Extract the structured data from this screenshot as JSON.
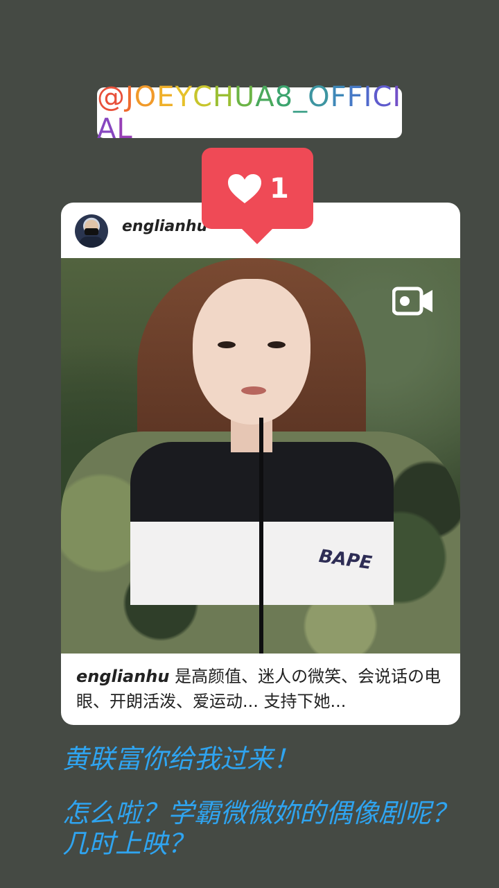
{
  "mention": {
    "text": "@JOEYCHUA8_OFFICIAL",
    "colors": [
      "#e8503a",
      "#ee6a2e",
      "#f19a2a",
      "#efb02a",
      "#e6c12a",
      "#c7c52c",
      "#9bbf34",
      "#6cb446",
      "#4aa95c",
      "#3ca46e",
      "#3b9f87",
      "#3d95a1",
      "#3f88b8",
      "#4679c6",
      "#5069cc",
      "#5f5bcd",
      "#7350c8",
      "#8646bf",
      "#973fb6"
    ]
  },
  "post": {
    "username": "englianhu",
    "brand_text": "BAPE",
    "caption_user": "englianhu",
    "caption_text": " 是高颜值、迷人の微笑、会说话の电眼、开朗活泼、爱运动... 支持下她..."
  },
  "like": {
    "count": "1",
    "color": "#ef4a56"
  },
  "messages": {
    "line1": "黄联富你给我过来！",
    "line2": "怎么啦？学霸微微妳的偶像剧呢？几时上映？"
  },
  "colors": {
    "background": "#454a44",
    "message": "#2fa4f0"
  }
}
